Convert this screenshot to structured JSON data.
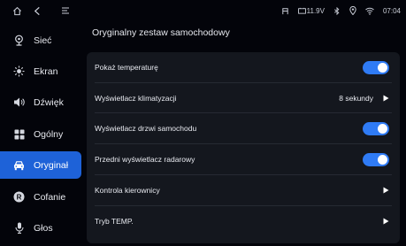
{
  "statusbar": {
    "voltage": "11.9V",
    "time": "07:04"
  },
  "sidebar": {
    "items": [
      {
        "label": "Sieć",
        "icon": "network-icon"
      },
      {
        "label": "Ekran",
        "icon": "brightness-icon"
      },
      {
        "label": "Dźwięk",
        "icon": "speaker-icon"
      },
      {
        "label": "Ogólny",
        "icon": "grid-icon"
      },
      {
        "label": "Oryginał",
        "icon": "car-icon",
        "active": true
      },
      {
        "label": "Cofanie",
        "icon": "reverse-icon"
      },
      {
        "label": "Głos",
        "icon": "microphone-icon"
      }
    ]
  },
  "main": {
    "title": "Oryginalny zestaw samochodowy",
    "rows": [
      {
        "label": "Pokaż temperaturę",
        "type": "toggle",
        "on": true
      },
      {
        "label": "Wyświetlacz klimatyzacji",
        "type": "value",
        "value": "8 sekundy"
      },
      {
        "label": "Wyświetlacz drzwi samochodu",
        "type": "toggle",
        "on": true
      },
      {
        "label": "Przedni wyświetlacz radarowy",
        "type": "toggle",
        "on": true
      },
      {
        "label": "Kontrola kierownicy",
        "type": "link"
      },
      {
        "label": "Tryb TEMP.",
        "type": "link"
      }
    ]
  },
  "colors": {
    "accent": "#1e62d8",
    "toggle_on": "#2f7bf5",
    "panel": "#14171e",
    "background": "#03040a"
  }
}
